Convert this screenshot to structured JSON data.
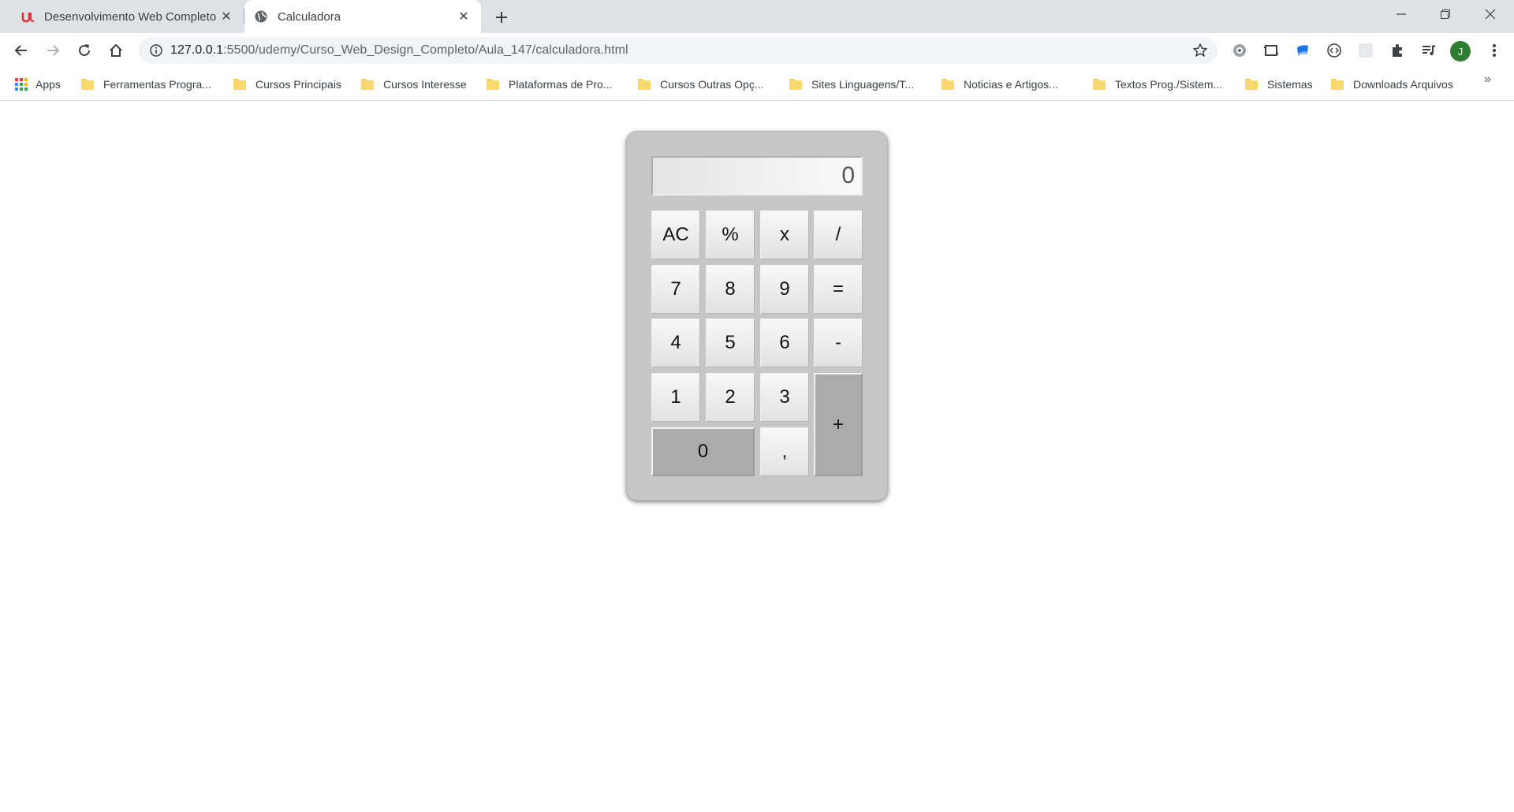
{
  "browser": {
    "tabs": [
      {
        "title": "Desenvolvimento Web Completo",
        "close": "✕"
      },
      {
        "title": "Calculadora",
        "close": "✕"
      }
    ],
    "new_tab": "+",
    "url_host": "127.0.0.1",
    "url_rest": ":5500/udemy/Curso_Web_Design_Completo/Aula_147/calculadora.html",
    "avatar_letter": "J",
    "bookmarks": [
      "Apps",
      "Ferramentas Progra...",
      "Cursos Principais",
      "Cursos Interesse",
      "Plataformas de Pro...",
      "Cursos Outras Opç...",
      "Sites Linguagens/T...",
      "Noticias e Artigos...",
      "Textos Prog./Sistem...",
      "Sistemas",
      "Downloads Arquivos"
    ],
    "bookmarks_more": "»"
  },
  "calculator": {
    "display": "0",
    "keys": {
      "ac": "AC",
      "percent": "%",
      "multiply": "x",
      "divide": "/",
      "seven": "7",
      "eight": "8",
      "nine": "9",
      "equals": "=",
      "four": "4",
      "five": "5",
      "six": "6",
      "minus": "-",
      "one": "1",
      "two": "2",
      "three": "3",
      "plus": "+",
      "zero": "0",
      "comma": ","
    }
  }
}
